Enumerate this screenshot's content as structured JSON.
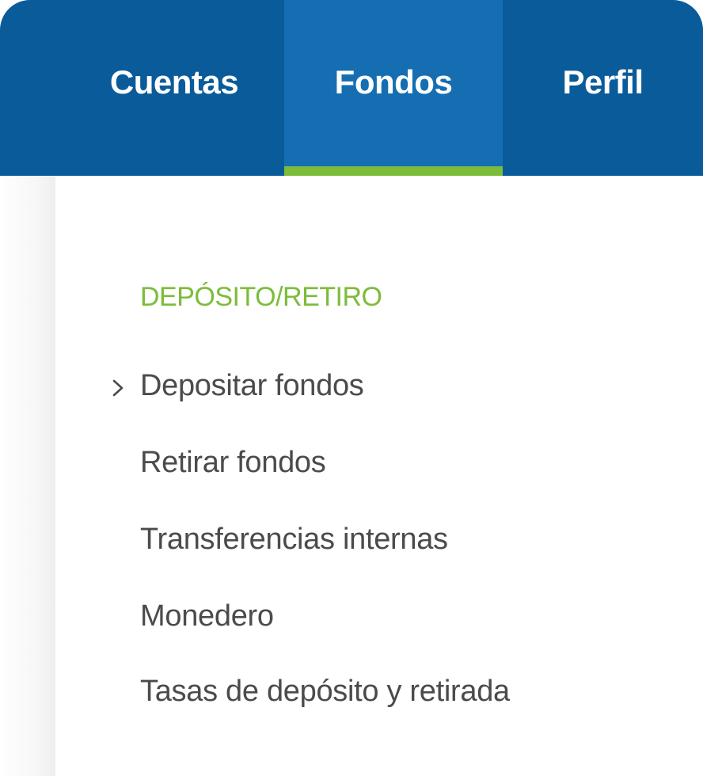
{
  "nav": {
    "tabs": [
      {
        "label": "Cuentas",
        "active": false
      },
      {
        "label": "Fondos",
        "active": true
      },
      {
        "label": "Perfil",
        "active": false
      }
    ],
    "active_indicator_color": "#7cbc3a",
    "background_color": "#0a5b9a",
    "active_tab_color": "#156eb2"
  },
  "dropdown": {
    "section_heading": "DEPÓSITO/RETIRO",
    "items": [
      {
        "label": "Depositar fondos",
        "selected": true,
        "icon": "chevron-right-icon"
      },
      {
        "label": "Retirar fondos"
      },
      {
        "label": "Transferencias internas"
      },
      {
        "label": "Monedero"
      },
      {
        "label": "Tasas de depósito y retirada"
      }
    ],
    "heading_color": "#7cbc3a",
    "item_color": "#4b4b4b"
  }
}
